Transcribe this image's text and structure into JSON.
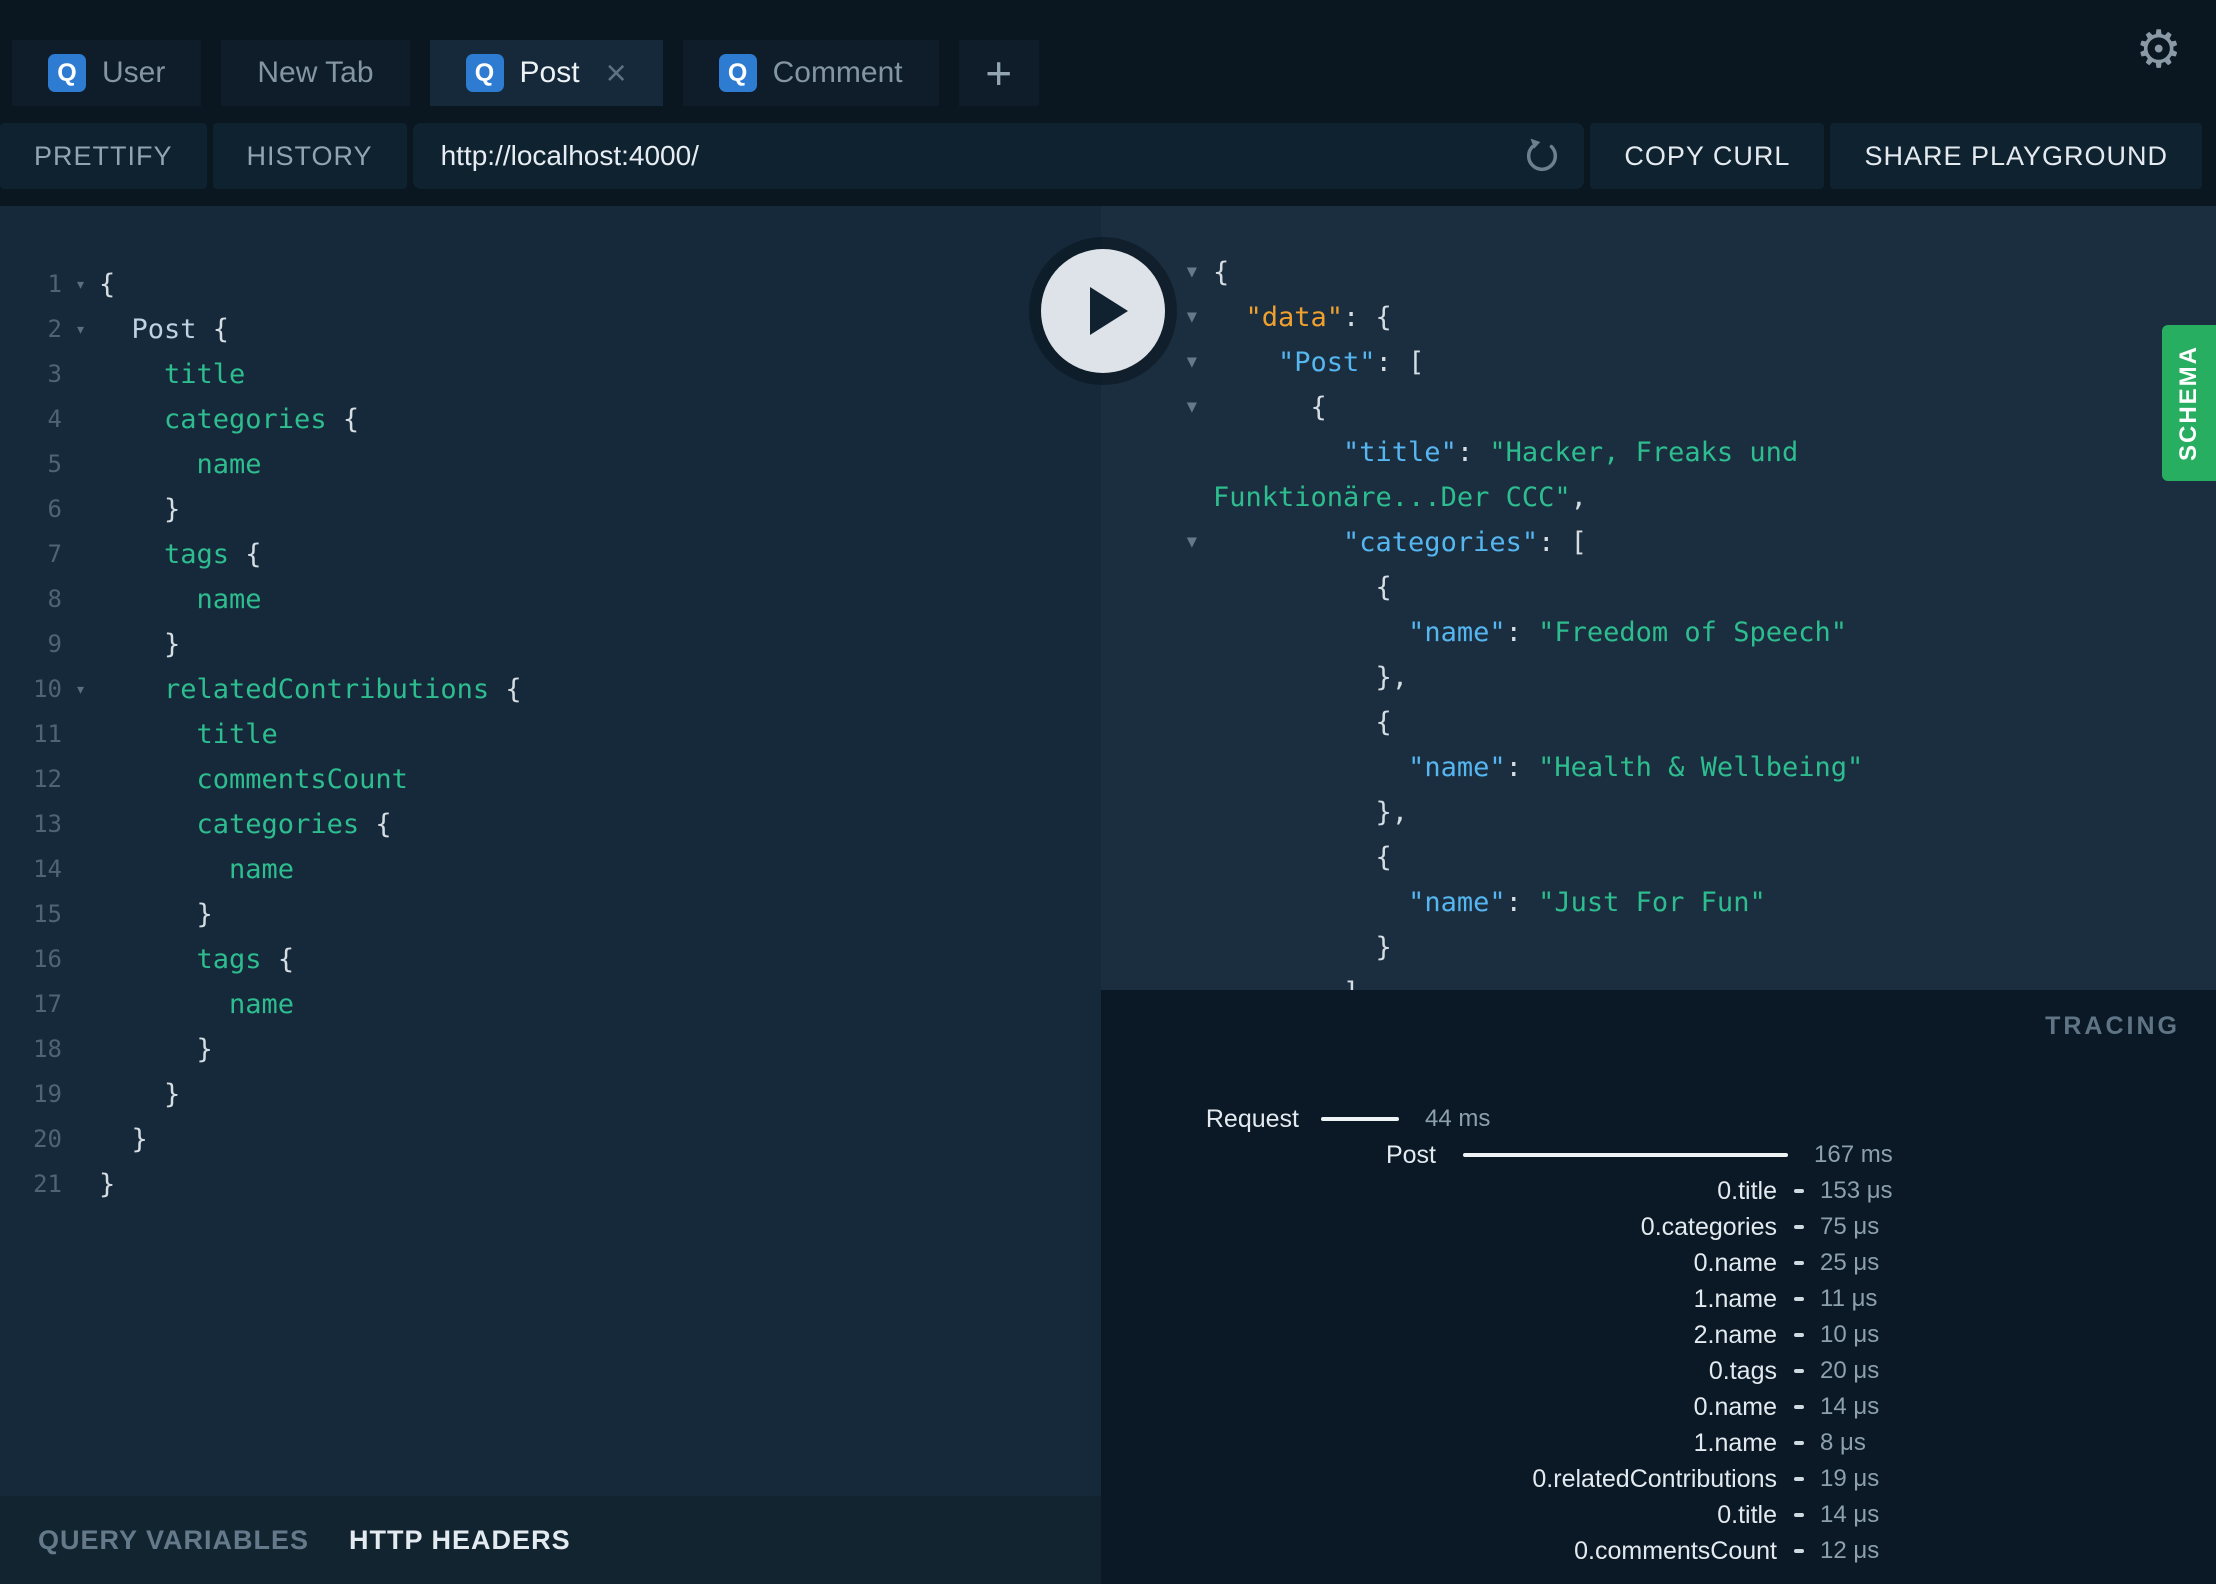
{
  "tabs": {
    "q_badge": "Q",
    "close_glyph": "×",
    "add_label": "+",
    "items": [
      {
        "label": "User",
        "q": true,
        "active": false
      },
      {
        "label": "New Tab",
        "q": false,
        "active": false
      },
      {
        "label": "Post",
        "q": true,
        "active": true,
        "closable": true
      },
      {
        "label": "Comment",
        "q": true,
        "active": false
      }
    ]
  },
  "toolbar": {
    "prettify": "PRETTIFY",
    "history": "HISTORY",
    "url": "http://localhost:4000/",
    "copy_curl": "COPY CURL",
    "share_playground": "SHARE PLAYGROUND"
  },
  "editor": {
    "footer": {
      "query_variables": "QUERY VARIABLES",
      "http_headers": "HTTP HEADERS"
    },
    "lines": [
      {
        "n": "1",
        "arrow": true,
        "ind": 0,
        "parts": [
          [
            "pn",
            "{"
          ]
        ]
      },
      {
        "n": "2",
        "arrow": true,
        "ind": 2,
        "parts": [
          [
            "typ",
            "Post"
          ],
          [
            "pn",
            " {"
          ]
        ]
      },
      {
        "n": "3",
        "arrow": false,
        "ind": 4,
        "parts": [
          [
            "fld",
            "title"
          ]
        ]
      },
      {
        "n": "4",
        "arrow": false,
        "ind": 4,
        "parts": [
          [
            "fld",
            "categories"
          ],
          [
            "pn",
            " {"
          ]
        ]
      },
      {
        "n": "5",
        "arrow": false,
        "ind": 6,
        "parts": [
          [
            "fld",
            "name"
          ]
        ]
      },
      {
        "n": "6",
        "arrow": false,
        "ind": 4,
        "parts": [
          [
            "pn",
            "}"
          ]
        ]
      },
      {
        "n": "7",
        "arrow": false,
        "ind": 4,
        "parts": [
          [
            "fld",
            "tags"
          ],
          [
            "pn",
            " {"
          ]
        ]
      },
      {
        "n": "8",
        "arrow": false,
        "ind": 6,
        "parts": [
          [
            "fld",
            "name"
          ]
        ]
      },
      {
        "n": "9",
        "arrow": false,
        "ind": 4,
        "parts": [
          [
            "pn",
            "}"
          ]
        ]
      },
      {
        "n": "10",
        "arrow": true,
        "ind": 4,
        "parts": [
          [
            "fld",
            "relatedContributions"
          ],
          [
            "pn",
            " {"
          ]
        ]
      },
      {
        "n": "11",
        "arrow": false,
        "ind": 6,
        "parts": [
          [
            "fld",
            "title"
          ]
        ]
      },
      {
        "n": "12",
        "arrow": false,
        "ind": 6,
        "parts": [
          [
            "fld",
            "commentsCount"
          ]
        ]
      },
      {
        "n": "13",
        "arrow": false,
        "ind": 6,
        "parts": [
          [
            "fld",
            "categories"
          ],
          [
            "pn",
            " {"
          ]
        ]
      },
      {
        "n": "14",
        "arrow": false,
        "ind": 8,
        "parts": [
          [
            "fld",
            "name"
          ]
        ]
      },
      {
        "n": "15",
        "arrow": false,
        "ind": 6,
        "parts": [
          [
            "pn",
            "}"
          ]
        ]
      },
      {
        "n": "16",
        "arrow": false,
        "ind": 6,
        "parts": [
          [
            "fld",
            "tags"
          ],
          [
            "pn",
            " {"
          ]
        ]
      },
      {
        "n": "17",
        "arrow": false,
        "ind": 8,
        "parts": [
          [
            "fld",
            "name"
          ]
        ]
      },
      {
        "n": "18",
        "arrow": false,
        "ind": 6,
        "parts": [
          [
            "pn",
            "}"
          ]
        ]
      },
      {
        "n": "19",
        "arrow": false,
        "ind": 4,
        "parts": [
          [
            "pn",
            "}"
          ]
        ]
      },
      {
        "n": "20",
        "arrow": false,
        "ind": 2,
        "parts": [
          [
            "pn",
            "}"
          ]
        ]
      },
      {
        "n": "21",
        "arrow": false,
        "ind": 0,
        "parts": [
          [
            "pn",
            "}"
          ]
        ]
      }
    ]
  },
  "result": {
    "schema_tab": "SCHEMA",
    "lines": [
      {
        "arrow": true,
        "ind": 0,
        "parts": [
          [
            "pn",
            "{"
          ]
        ]
      },
      {
        "arrow": true,
        "ind": 2,
        "parts": [
          [
            "keyd",
            "\"data\""
          ],
          [
            "pn",
            ": {"
          ]
        ]
      },
      {
        "arrow": true,
        "ind": 4,
        "parts": [
          [
            "key",
            "\"Post\""
          ],
          [
            "pn",
            ": ["
          ]
        ]
      },
      {
        "arrow": true,
        "ind": 6,
        "parts": [
          [
            "pn",
            "{"
          ]
        ]
      },
      {
        "arrow": false,
        "ind": 8,
        "parts": [
          [
            "key",
            "\"title\""
          ],
          [
            "pn",
            ": "
          ],
          [
            "str",
            "\"Hacker, Freaks und"
          ]
        ]
      },
      {
        "arrow": false,
        "ind": 0,
        "parts": [
          [
            "str",
            "Funktionäre...Der CCC\""
          ],
          [
            "pn",
            ","
          ]
        ]
      },
      {
        "arrow": true,
        "ind": 8,
        "parts": [
          [
            "key",
            "\"categories\""
          ],
          [
            "pn",
            ": ["
          ]
        ]
      },
      {
        "arrow": false,
        "ind": 10,
        "parts": [
          [
            "pn",
            "{"
          ]
        ]
      },
      {
        "arrow": false,
        "ind": 12,
        "parts": [
          [
            "key",
            "\"name\""
          ],
          [
            "pn",
            ": "
          ],
          [
            "str",
            "\"Freedom of Speech\""
          ]
        ]
      },
      {
        "arrow": false,
        "ind": 10,
        "parts": [
          [
            "pn",
            "},"
          ]
        ]
      },
      {
        "arrow": false,
        "ind": 10,
        "parts": [
          [
            "pn",
            "{"
          ]
        ]
      },
      {
        "arrow": false,
        "ind": 12,
        "parts": [
          [
            "key",
            "\"name\""
          ],
          [
            "pn",
            ": "
          ],
          [
            "str",
            "\"Health & Wellbeing\""
          ]
        ]
      },
      {
        "arrow": false,
        "ind": 10,
        "parts": [
          [
            "pn",
            "},"
          ]
        ]
      },
      {
        "arrow": false,
        "ind": 10,
        "parts": [
          [
            "pn",
            "{"
          ]
        ]
      },
      {
        "arrow": false,
        "ind": 12,
        "parts": [
          [
            "key",
            "\"name\""
          ],
          [
            "pn",
            ": "
          ],
          [
            "str",
            "\"Just For Fun\""
          ]
        ]
      },
      {
        "arrow": false,
        "ind": 10,
        "parts": [
          [
            "pn",
            "}"
          ]
        ]
      },
      {
        "arrow": false,
        "ind": 8,
        "parts": [
          [
            "pn",
            "]"
          ]
        ]
      }
    ]
  },
  "tracing": {
    "title": "TRACING",
    "rows": [
      {
        "kind": "request",
        "label": "Request",
        "bar": 78,
        "time": "44 ms"
      },
      {
        "kind": "root",
        "label": "Post",
        "bar": 325,
        "time": "167 ms"
      },
      {
        "kind": "field",
        "label": "0.title",
        "time": "153 μs"
      },
      {
        "kind": "field",
        "label": "0.categories",
        "time": "75 μs"
      },
      {
        "kind": "field",
        "label": "0.name",
        "time": "25 μs"
      },
      {
        "kind": "field",
        "label": "1.name",
        "time": "11 μs"
      },
      {
        "kind": "field",
        "label": "2.name",
        "time": "10 μs"
      },
      {
        "kind": "field",
        "label": "0.tags",
        "time": "20 μs"
      },
      {
        "kind": "field",
        "label": "0.name",
        "time": "14 μs"
      },
      {
        "kind": "field",
        "label": "1.name",
        "time": "8 μs"
      },
      {
        "kind": "field",
        "label": "0.relatedContributions",
        "time": "19 μs"
      },
      {
        "kind": "field",
        "label": "0.title",
        "time": "14 μs"
      },
      {
        "kind": "field",
        "label": "0.commentsCount",
        "time": "12 μs"
      }
    ]
  },
  "colors": {
    "accent_blue": "#2d7cd1",
    "schema_green": "#27ae60",
    "field_green": "#2dbd8f",
    "key_blue": "#56b6f0",
    "data_orange": "#f0a12d",
    "editor_bg": "#16293a",
    "result_bg": "#1b2e3f",
    "dark_bg": "#0a1620"
  }
}
